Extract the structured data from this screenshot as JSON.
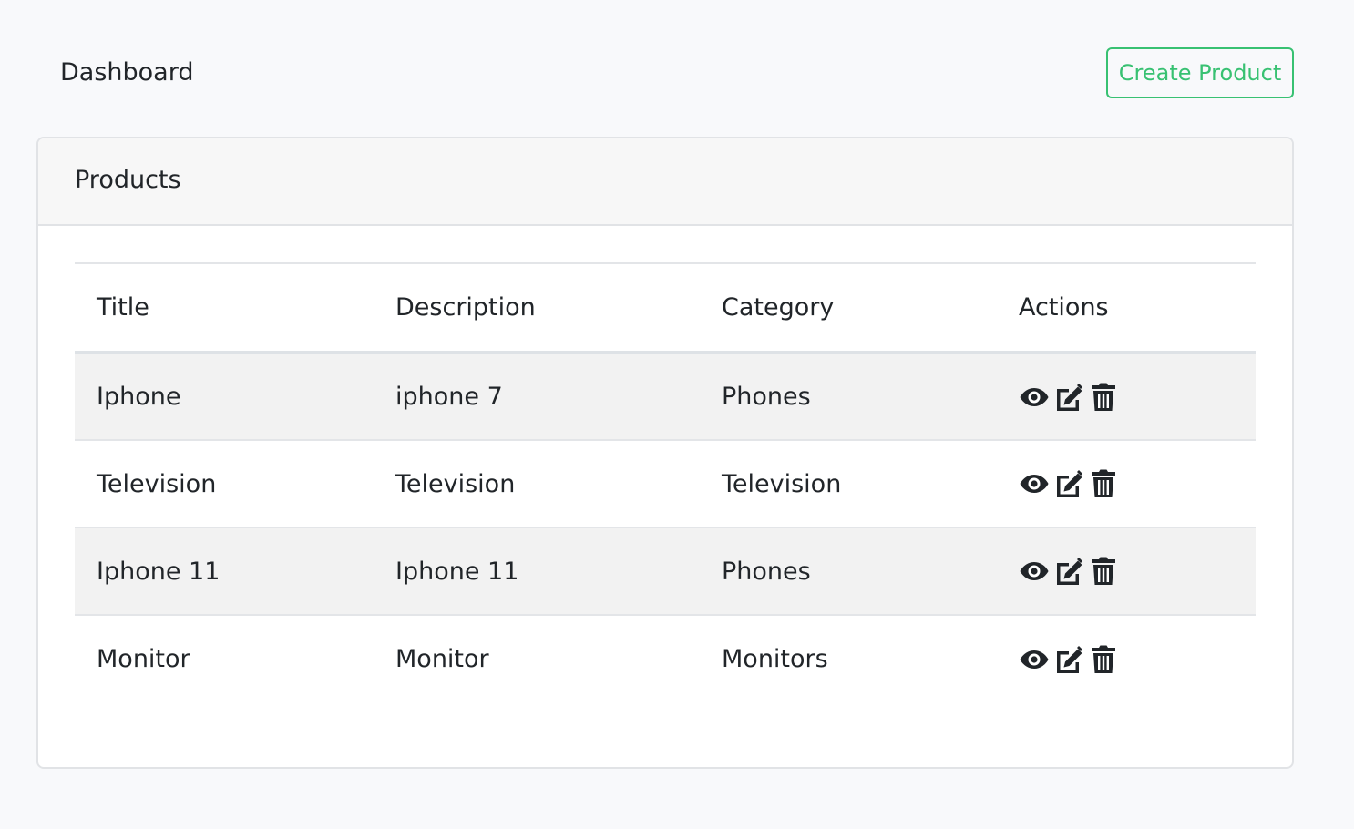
{
  "header": {
    "title": "Dashboard",
    "create_button": "Create Product"
  },
  "card": {
    "title": "Products"
  },
  "table": {
    "columns": [
      "Title",
      "Description",
      "Category",
      "Actions"
    ],
    "rows": [
      {
        "title": "Iphone",
        "description": "iphone 7",
        "category": "Phones"
      },
      {
        "title": "Television",
        "description": "Television",
        "category": "Television"
      },
      {
        "title": "Iphone 11",
        "description": "Iphone 11",
        "category": "Phones"
      },
      {
        "title": "Monitor",
        "description": "Monitor",
        "category": "Monitors"
      }
    ],
    "row_actions": [
      "eye-icon",
      "edit-icon",
      "trash-icon"
    ]
  },
  "colors": {
    "accent": "#38c172",
    "background": "#f8f9fb",
    "stripe": "#f2f2f2",
    "text": "#212529"
  }
}
